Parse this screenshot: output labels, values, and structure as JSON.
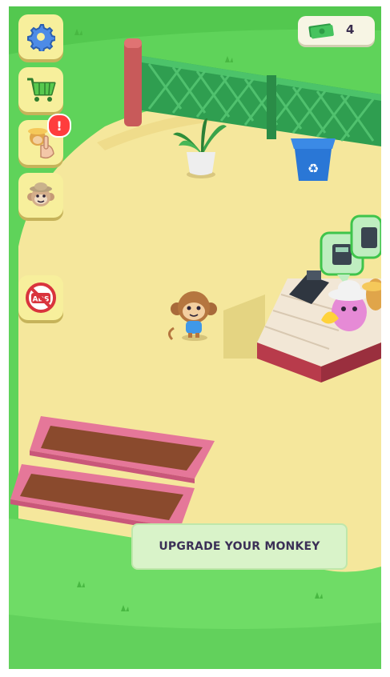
{
  "hud": {
    "money": {
      "icon": "cash-icon",
      "value": "4"
    },
    "colors": {
      "grass": "#5fd35a",
      "sand": "#f5e79c",
      "panel": "#f7ef9c",
      "alert": "#ff3d3d",
      "fence": "#2f9e50"
    }
  },
  "sidebar": {
    "items": [
      {
        "name": "settings",
        "icon": "gear-icon"
      },
      {
        "name": "shop",
        "icon": "shopping-cart-icon"
      },
      {
        "name": "hire",
        "icon": "monkey-worker-icon",
        "badge": "!"
      },
      {
        "name": "monkey-profile",
        "icon": "monkey-face-icon"
      },
      {
        "name": "no-ads",
        "icon": "no-ads-icon",
        "label": "ADS"
      }
    ]
  },
  "banner": {
    "text": "UPGRADE YOUR MONKEY"
  }
}
